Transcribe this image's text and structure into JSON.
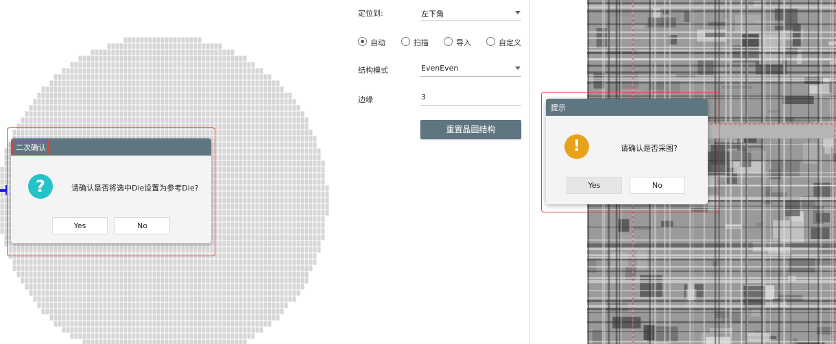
{
  "settings": {
    "locate_label": "定位到:",
    "locate_value": "左下角",
    "modes": [
      {
        "label": "自动",
        "selected": true
      },
      {
        "label": "扫描",
        "selected": false
      },
      {
        "label": "导入",
        "selected": false
      },
      {
        "label": "自定义",
        "selected": false
      }
    ],
    "structure_label": "结构模式",
    "structure_value": "EvenEven",
    "edge_label": "边缘",
    "edge_value": "3",
    "reset_button": "重置晶圆结构"
  },
  "confirm_dialog": {
    "title": "二次确认",
    "message": "请确认是否将选中Die设置为参考Die?",
    "icon": "question-icon",
    "yes": "Yes",
    "no": "No"
  },
  "prompt_dialog": {
    "title": "提示",
    "message": "请确认是否采图?",
    "icon": "warning-icon",
    "yes": "Yes",
    "no": "No"
  },
  "colors": {
    "title_bar": "#5f7680",
    "highlight": "#e0413a",
    "question_icon": "#23c3c9",
    "warning_icon": "#e8a31d",
    "wafer_die": "#d6d6d6",
    "reference_marker": "#1e22e0"
  }
}
